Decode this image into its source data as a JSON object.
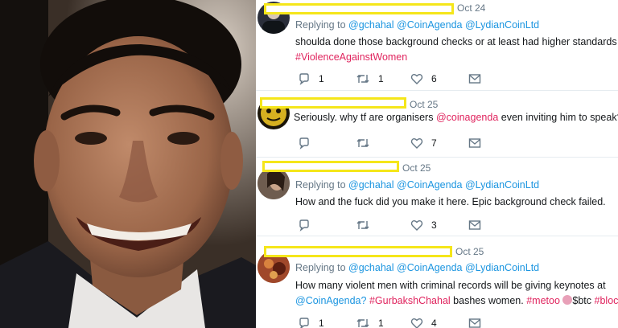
{
  "tweets": [
    {
      "date": "Oct 24",
      "reply_prefix": "Replying to",
      "mentions": [
        "@gchahal",
        "@CoinAgenda",
        "@LydianCoinLtd"
      ],
      "text": "shoulda done those background checks or at least had higher standards",
      "hashtag": "#ViolenceAgainstWomen",
      "replies": "1",
      "retweets": "1",
      "likes": "6"
    },
    {
      "date": "Oct 25",
      "text_before": "Seriously. why tf are organisers ",
      "mention": "@coinagenda",
      "text_after": " even inviting him to speak?",
      "replies": "",
      "retweets": "",
      "likes": "7"
    },
    {
      "date": "Oct 25",
      "reply_prefix": "Replying to",
      "mentions": [
        "@gchahal",
        "@CoinAgenda",
        "@LydianCoinLtd"
      ],
      "text": "How and the fuck did you make it here. Epic background check failed.",
      "replies": "",
      "retweets": "",
      "likes": "3"
    },
    {
      "date": "Oct 25",
      "reply_prefix": "Replying to",
      "mentions": [
        "@gchahal",
        "@CoinAgenda",
        "@LydianCoinLtd"
      ],
      "line1": "How many violent men with criminal records will be giving keynotes at",
      "mention": "@CoinAgenda?",
      "hashtag1": "#GurbakshChahal",
      "mid": " bashes women. ",
      "hashtag2": "#metoo",
      "cashtag": "$btc",
      "hashtag3": "#blocl",
      "replies": "1",
      "retweets": "1",
      "likes": "4"
    }
  ]
}
